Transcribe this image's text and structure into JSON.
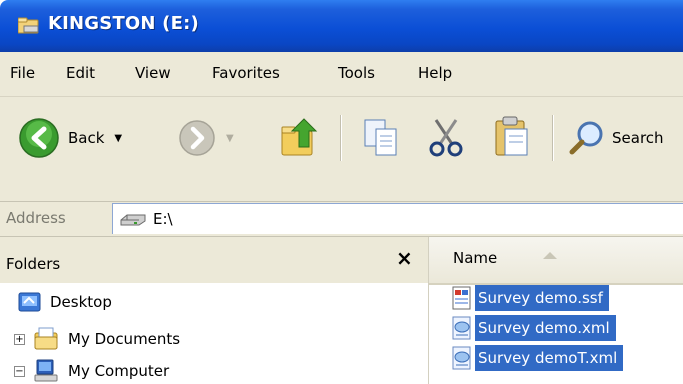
{
  "window": {
    "title": "KINGSTON (E:)",
    "title_icon": "drive-folder-icon",
    "accent_color": "#0b4fd6"
  },
  "menu": {
    "items": [
      "File",
      "Edit",
      "View",
      "Favorites",
      "Tools",
      "Help"
    ]
  },
  "toolbar": {
    "back_label": "Back",
    "search_label": "Search",
    "icons": [
      "back-arrow-icon",
      "forward-arrow-icon",
      "up-folder-icon",
      "copy-icon",
      "cut-icon",
      "paste-icon",
      "search-icon"
    ]
  },
  "address": {
    "label": "Address",
    "value": "E:\\"
  },
  "folders": {
    "title": "Folders",
    "close": "×",
    "tree": [
      {
        "label": "Desktop",
        "icon": "desktop-icon"
      },
      {
        "label": "My Documents",
        "icon": "my-documents-icon",
        "expander": "+"
      },
      {
        "label": "My Computer",
        "icon": "my-computer-icon",
        "expander": "−"
      }
    ]
  },
  "files": {
    "column_name": "Name",
    "selection_color": "#316ac5",
    "items": [
      {
        "name": "Survey demo.ssf",
        "icon": "ssf-file-icon"
      },
      {
        "name": "Survey demo.xml",
        "icon": "xml-file-icon"
      },
      {
        "name": "Survey demoT.xml",
        "icon": "xml-file-icon"
      }
    ]
  }
}
